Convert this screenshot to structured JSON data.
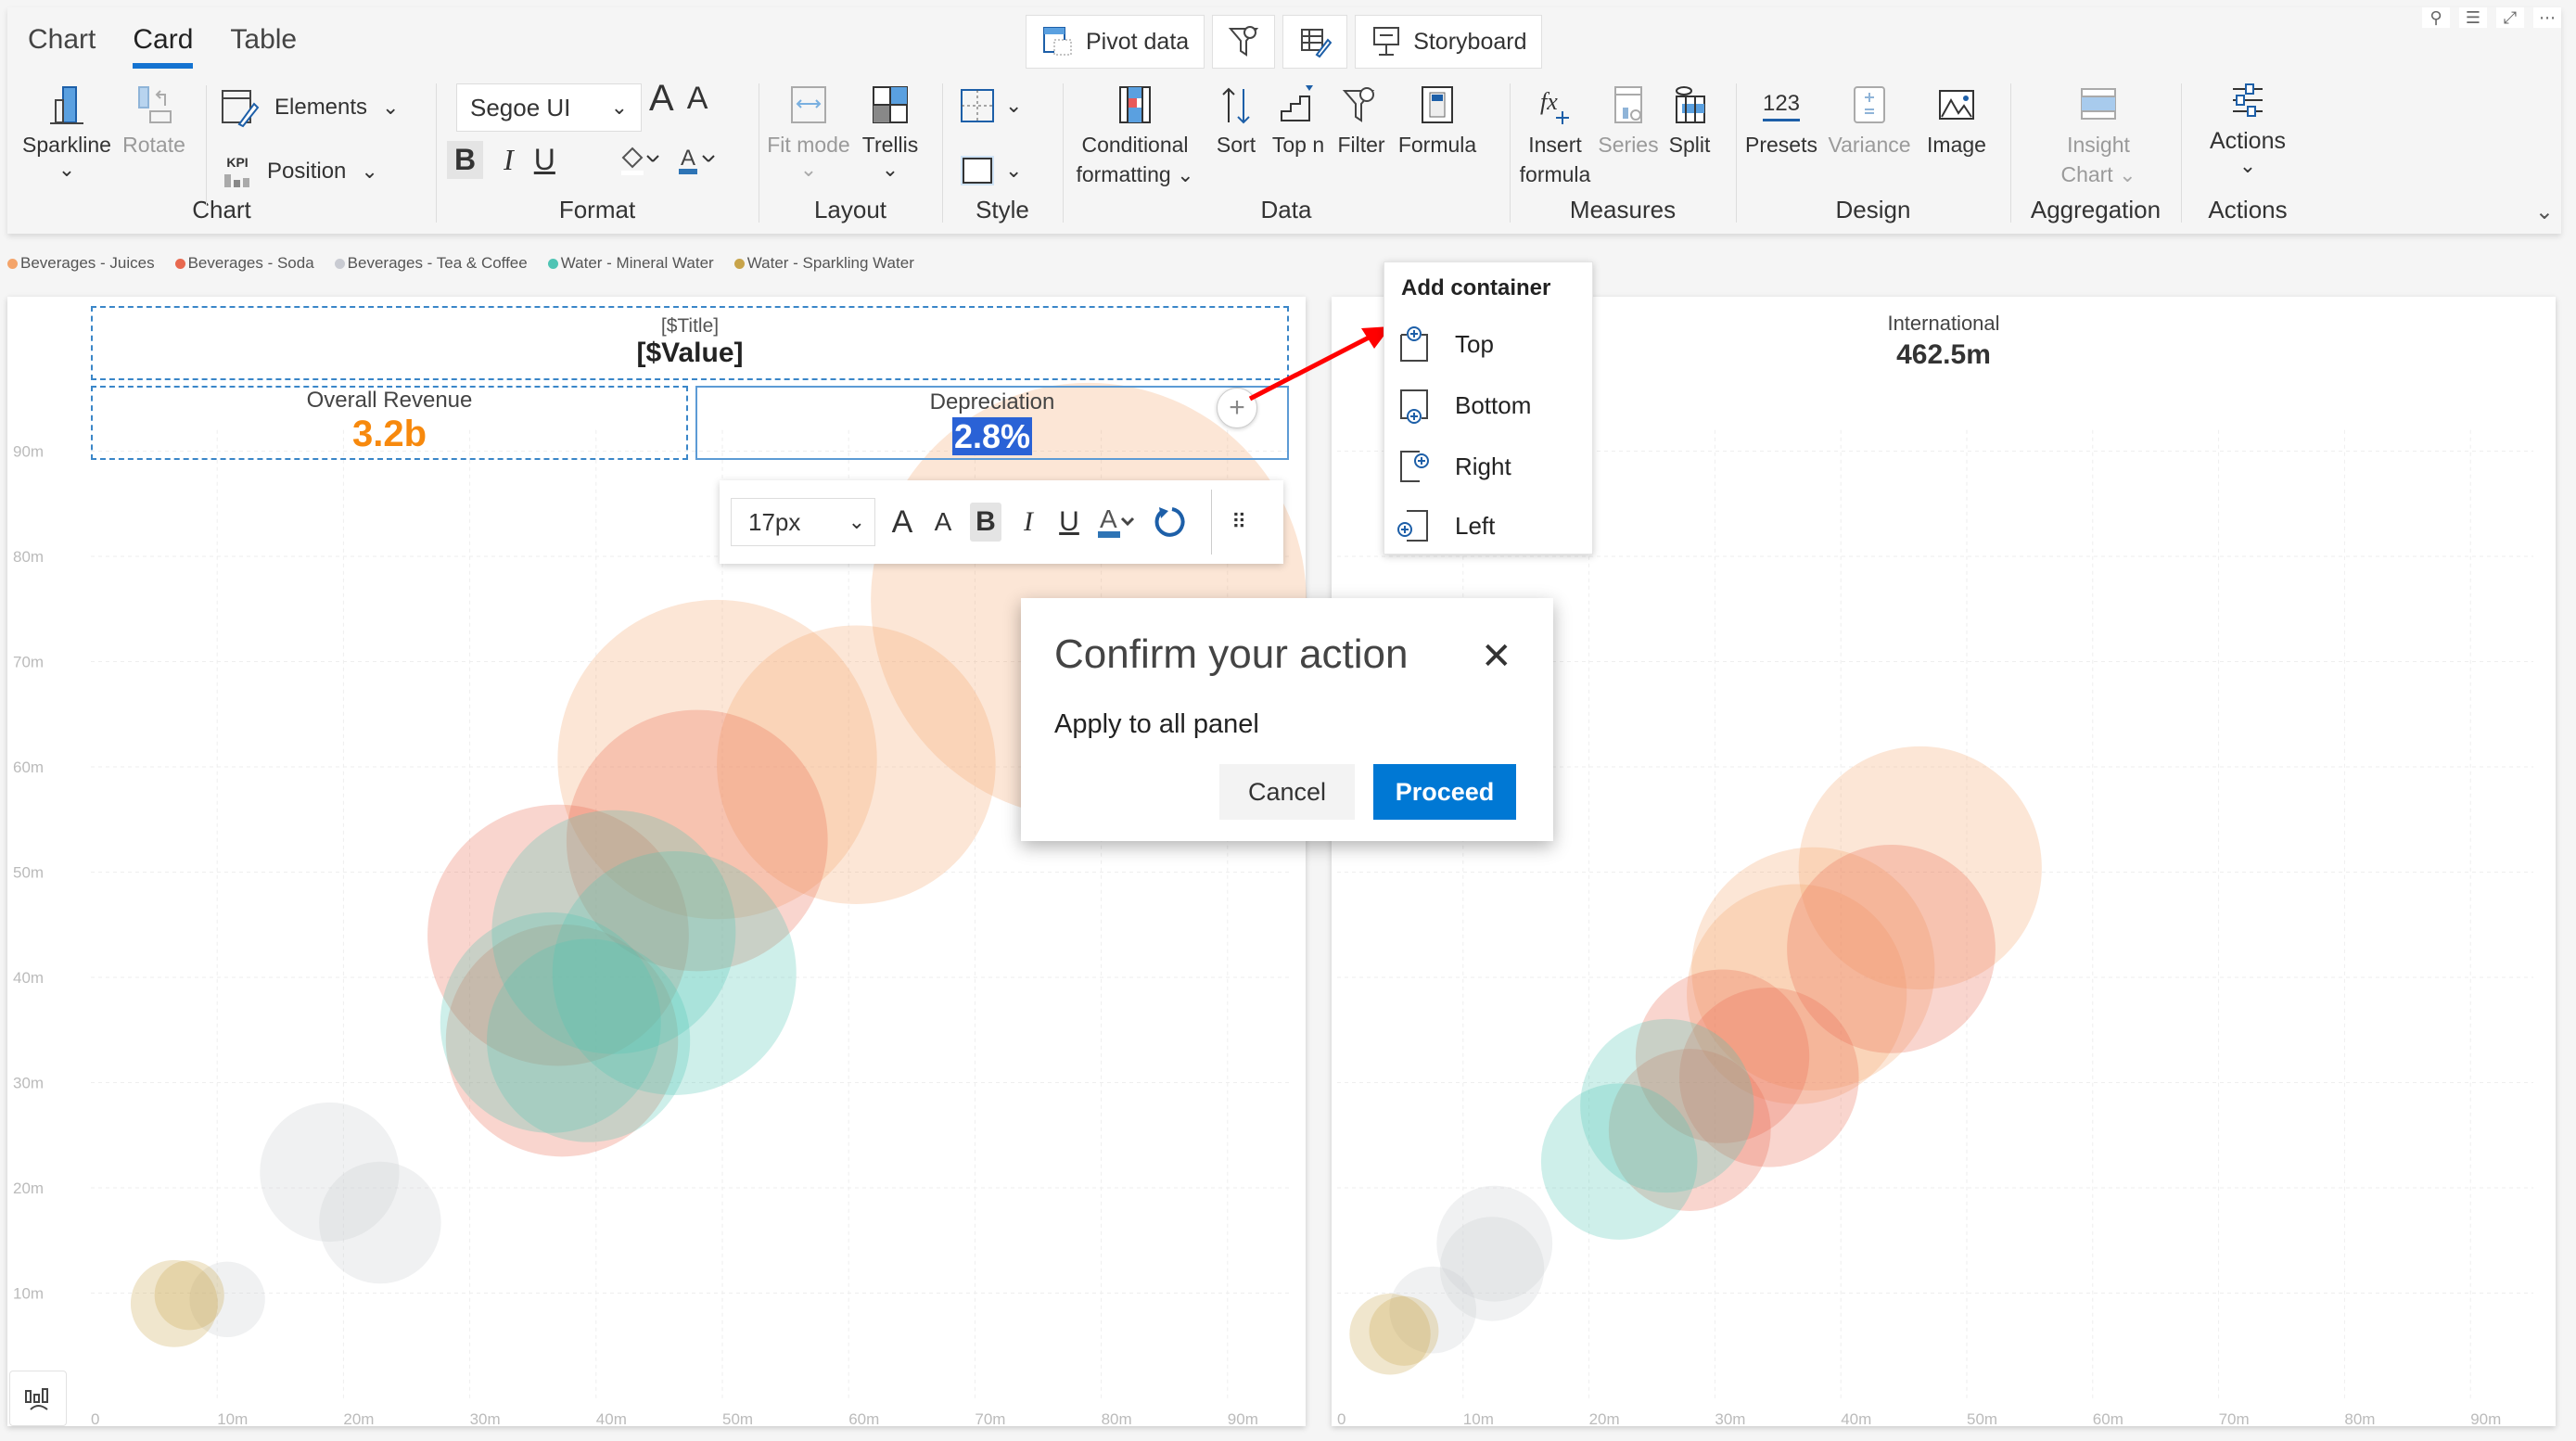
{
  "ribbon": {
    "tabs": [
      {
        "label": "Chart"
      },
      {
        "label": "Card",
        "active": true
      },
      {
        "label": "Table"
      }
    ],
    "top_buttons": {
      "pivot_data": "Pivot data",
      "storyboard": "Storyboard"
    },
    "groups": {
      "chart": {
        "label": "Chart",
        "sparkline": "Sparkline",
        "rotate": "Rotate",
        "elements": "Elements",
        "position": "Position",
        "kpi_badge": "KPI"
      },
      "format": {
        "label": "Format",
        "font": "Segoe UI",
        "bold": "B",
        "italic": "I",
        "underline": "U",
        "grow": "A",
        "shrink": "A"
      },
      "layout": {
        "label": "Layout",
        "fit_mode": "Fit mode",
        "trellis": "Trellis"
      },
      "style": {
        "label": "Style"
      },
      "data": {
        "label": "Data",
        "conditional_1": "Conditional",
        "conditional_2": "formatting",
        "sort": "Sort",
        "top_n": "Top n",
        "filter": "Filter",
        "formula": "Formula"
      },
      "measures": {
        "label": "Measures",
        "insert_1": "Insert",
        "insert_2": "formula",
        "series": "Series",
        "split": "Split"
      },
      "design": {
        "label": "Design",
        "presets": "Presets",
        "presets_icon_text": "123",
        "variance": "Variance",
        "image": "Image"
      },
      "aggregation": {
        "label": "Aggregation",
        "insight_1": "Insight",
        "insight_2": "Chart"
      },
      "actions": {
        "label": "Actions",
        "actions": "Actions"
      }
    }
  },
  "legend": [
    {
      "label": "Beverages - Juices",
      "color": "#f4a46a"
    },
    {
      "label": "Beverages - Soda",
      "color": "#e8694f"
    },
    {
      "label": "Beverages - Tea & Coffee",
      "color": "#c9cbd2"
    },
    {
      "label": "Water - Mineral Water",
      "color": "#4fc4b4"
    },
    {
      "label": "Water - Sparkling Water",
      "color": "#c8a44a"
    }
  ],
  "left_panel": {
    "card": {
      "title_placeholder": "[$Title]",
      "value_placeholder": "[$Value]"
    },
    "kpis": [
      {
        "title": "Overall Revenue",
        "value": "3.2b"
      },
      {
        "title": "Depreciation",
        "value": "2.8%"
      }
    ]
  },
  "right_panel": {
    "kpi": {
      "title": "International",
      "value": "462.5m"
    }
  },
  "format_toolbar": {
    "font_size": "17px",
    "bold": "B",
    "italic": "I",
    "underline": "U",
    "grow": "A",
    "shrink": "A",
    "color": "A"
  },
  "add_container_menu": {
    "title": "Add container",
    "items": [
      {
        "label": "Top"
      },
      {
        "label": "Bottom"
      },
      {
        "label": "Right"
      },
      {
        "label": "Left"
      }
    ]
  },
  "dialog": {
    "title": "Confirm your action",
    "message": "Apply to all panel",
    "cancel": "Cancel",
    "proceed": "Proceed"
  },
  "chart_data": [
    {
      "type": "scatter",
      "subtype": "bubble",
      "title": "",
      "xlabel": "",
      "ylabel": "",
      "xlim": [
        0,
        95
      ],
      "ylim": [
        0,
        92
      ],
      "x_ticks": [
        "0",
        "10m",
        "20m",
        "30m",
        "40m",
        "50m",
        "60m",
        "70m",
        "80m",
        "90m"
      ],
      "y_ticks": [
        "10m",
        "20m",
        "30m",
        "40m",
        "50m",
        "60m",
        "70m",
        "80m",
        "90m"
      ],
      "grid": true,
      "legend": "top-left",
      "series": [
        {
          "name": "Beverages - Juices",
          "color": "#f4a46a",
          "points": [
            {
              "x": 49.6,
              "y": 60.7,
              "size": 55
            },
            {
              "x": 60.6,
              "y": 60.2,
              "size": 48
            },
            {
              "x": 79,
              "y": 75.8,
              "size": 75
            }
          ]
        },
        {
          "name": "Beverages - Soda",
          "color": "#e8694f",
          "points": [
            {
              "x": 48,
              "y": 53,
              "size": 45
            },
            {
              "x": 37,
              "y": 44,
              "size": 45
            },
            {
              "x": 37.3,
              "y": 34,
              "size": 40
            }
          ]
        },
        {
          "name": "Water - Mineral Water",
          "color": "#4fc4b4",
          "points": [
            {
              "x": 41.4,
              "y": 44.3,
              "size": 42
            },
            {
              "x": 46.2,
              "y": 40.4,
              "size": 42
            },
            {
              "x": 36.4,
              "y": 35.7,
              "size": 38
            },
            {
              "x": 39.4,
              "y": 34,
              "size": 35
            }
          ]
        },
        {
          "name": "Beverages - Tea & Coffee",
          "color": "#c9cbd2",
          "points": [
            {
              "x": 18.9,
              "y": 21.5,
              "size": 24
            },
            {
              "x": 22.9,
              "y": 16.7,
              "size": 21
            },
            {
              "x": 10.8,
              "y": 9.4,
              "size": 13
            }
          ]
        },
        {
          "name": "Water - Sparkling Water",
          "color": "#c8a44a",
          "points": [
            {
              "x": 6.6,
              "y": 9,
              "size": 15
            },
            {
              "x": 7.8,
              "y": 9.8,
              "size": 12
            }
          ]
        }
      ]
    },
    {
      "type": "scatter",
      "subtype": "bubble",
      "title": "International",
      "xlabel": "",
      "ylabel": "",
      "xlim": [
        0,
        95
      ],
      "ylim": [
        0,
        92
      ],
      "x_ticks": [
        "0",
        "10m",
        "20m",
        "30m",
        "40m",
        "50m",
        "60m",
        "70m",
        "80m",
        "90m"
      ],
      "grid": true,
      "series": [
        {
          "name": "Beverages - Juices",
          "color": "#f4a46a",
          "points": [
            {
              "x": 46.3,
              "y": 50.4,
              "size": 42
            },
            {
              "x": 37.8,
              "y": 40.8,
              "size": 42
            },
            {
              "x": 36.5,
              "y": 38.4,
              "size": 38
            }
          ]
        },
        {
          "name": "Beverages - Soda",
          "color": "#e8694f",
          "points": [
            {
              "x": 44,
              "y": 42.7,
              "size": 36
            },
            {
              "x": 30.6,
              "y": 32.5,
              "size": 30
            },
            {
              "x": 34.3,
              "y": 30.5,
              "size": 31
            },
            {
              "x": 28,
              "y": 25.5,
              "size": 28
            }
          ]
        },
        {
          "name": "Water - Mineral Water",
          "color": "#4fc4b4",
          "points": [
            {
              "x": 26.2,
              "y": 27.8,
              "size": 30
            },
            {
              "x": 22.4,
              "y": 22.5,
              "size": 27
            }
          ]
        },
        {
          "name": "Beverages - Tea & Coffee",
          "color": "#c9cbd2",
          "points": [
            {
              "x": 12.5,
              "y": 14.7,
              "size": 20
            },
            {
              "x": 12.3,
              "y": 12.3,
              "size": 18
            },
            {
              "x": 7.6,
              "y": 8.4,
              "size": 15
            }
          ]
        },
        {
          "name": "Water - Sparkling Water",
          "color": "#c8a44a",
          "points": [
            {
              "x": 4.2,
              "y": 6.1,
              "size": 14
            },
            {
              "x": 5.3,
              "y": 6.4,
              "size": 12
            }
          ]
        }
      ]
    }
  ]
}
